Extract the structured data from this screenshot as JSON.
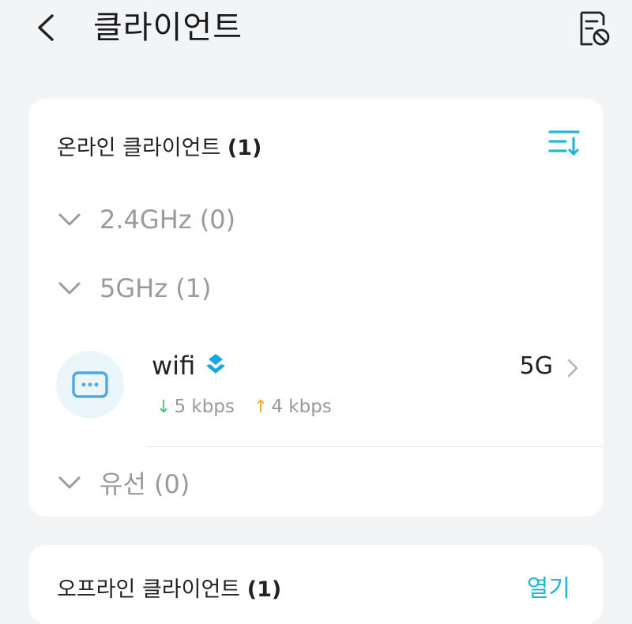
{
  "header": {
    "title": "클라이언트",
    "back_icon": "chevron-left-icon",
    "action_icon": "blocked-list-icon"
  },
  "online": {
    "title": "온라인 클라이언트",
    "count": "(1)",
    "sort_icon": "sort-icon",
    "groups": [
      {
        "label": "2.4GHz (0)"
      },
      {
        "label": "5GHz (1)"
      },
      {
        "label": "유선 (0)"
      }
    ],
    "clients": [
      {
        "name": "wifi",
        "band": "5G",
        "down_rate": "5 kbps",
        "up_rate": "4 kbps",
        "device_icon": "router-icon"
      }
    ]
  },
  "offline": {
    "title": "오프라인 클라이언트",
    "count": "(1)",
    "open_label": "열기"
  },
  "colors": {
    "accent": "#22b7d6",
    "download": "#3cc46a",
    "upload": "#f5a623",
    "muted": "#9a9a9a",
    "background": "#f3f4f6"
  }
}
